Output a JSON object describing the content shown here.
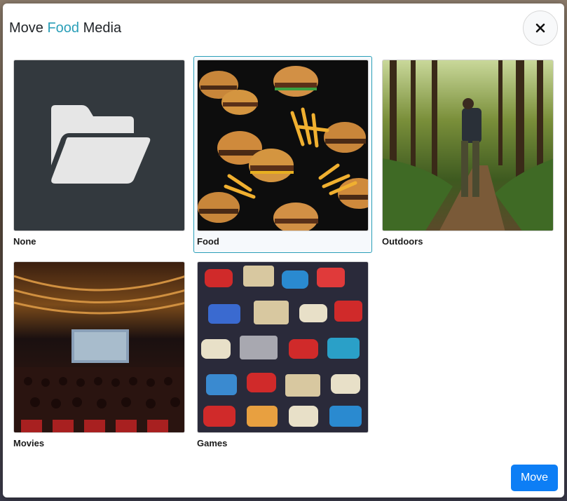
{
  "modal": {
    "title_prefix": "Move ",
    "title_accent": "Food",
    "title_suffix": " Media",
    "close_icon": "close-icon",
    "move_label": "Move",
    "accent_color": "#2a9fb8",
    "button_color": "#0d7ef5"
  },
  "albums": [
    {
      "label": "None",
      "selected": false,
      "thumb": "folder-open-icon"
    },
    {
      "label": "Food",
      "selected": true,
      "thumb": "burgers-and-fries-image"
    },
    {
      "label": "Outdoors",
      "selected": false,
      "thumb": "forest-hiker-image"
    },
    {
      "label": "Movies",
      "selected": false,
      "thumb": "movie-theater-image"
    },
    {
      "label": "Games",
      "selected": false,
      "thumb": "game-controllers-image"
    }
  ]
}
